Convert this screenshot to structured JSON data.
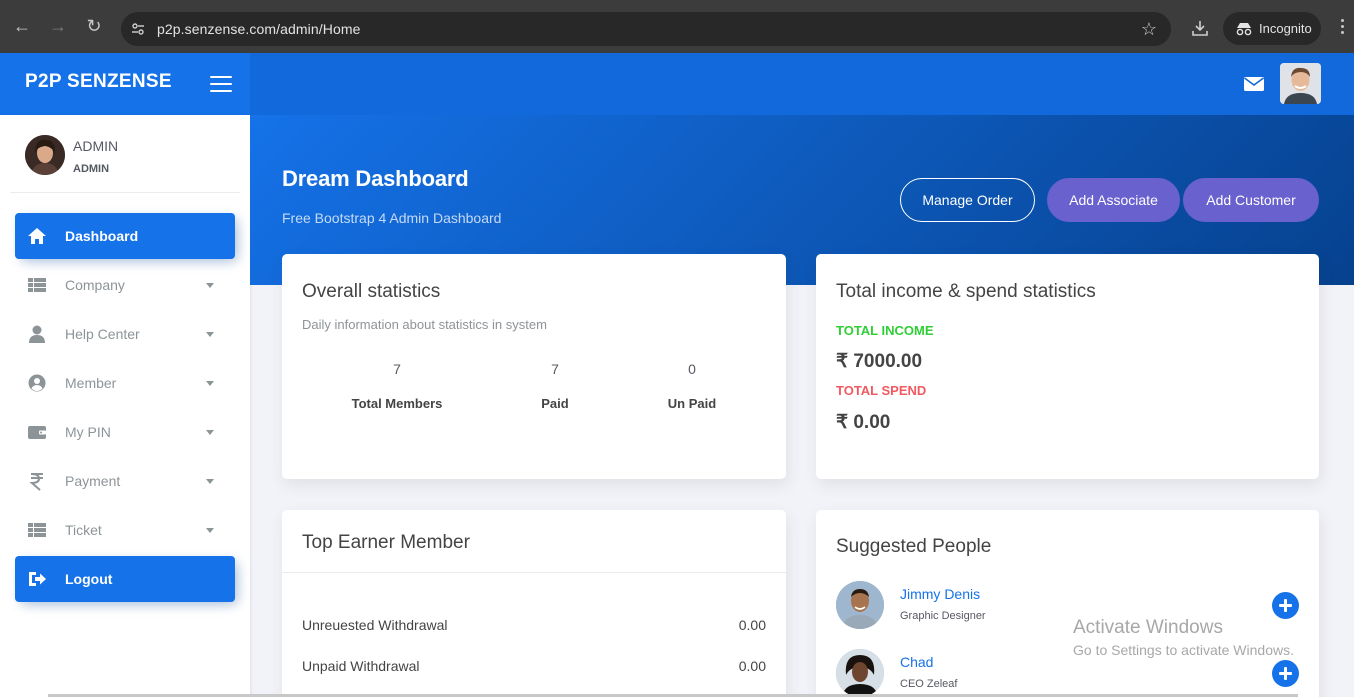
{
  "browser": {
    "url_domain": "p2p.senzense.com",
    "url_path": "/admin/Home",
    "incognito_label": "Incognito"
  },
  "sidebar": {
    "brand": "P2P SENZENSE",
    "user_name": "ADMIN",
    "user_role": "ADMIN",
    "items": [
      {
        "label": "Dashboard",
        "icon": "home-icon",
        "active": true
      },
      {
        "label": "Company",
        "icon": "table-icon"
      },
      {
        "label": "Help Center",
        "icon": "user-icon"
      },
      {
        "label": "Member",
        "icon": "user-circle-icon"
      },
      {
        "label": "My PIN",
        "icon": "wallet-icon"
      },
      {
        "label": "Payment",
        "icon": "rupee-icon"
      },
      {
        "label": "Ticket",
        "icon": "table-icon"
      },
      {
        "label": "Logout",
        "icon": "sign-out-icon",
        "active": true
      }
    ]
  },
  "header": {
    "title": "Dream Dashboard",
    "subtitle": "Free Bootstrap 4 Admin Dashboard",
    "buttons": {
      "manage_order": "Manage Order",
      "add_associate": "Add Associate",
      "add_customer": "Add Customer"
    }
  },
  "overall": {
    "title": "Overall statistics",
    "category": "Daily information about statistics in system",
    "stats": [
      {
        "value": "7",
        "label": "Total Members"
      },
      {
        "value": "7",
        "label": "Paid"
      },
      {
        "value": "0",
        "label": "Un Paid"
      }
    ]
  },
  "income": {
    "title": "Total income & spend statistics",
    "income_label": "TOTAL INCOME",
    "income_value": "₹ 7000.00",
    "spend_label": "TOTAL SPEND",
    "spend_value": "₹ 0.00",
    "income_color": "#31ce36",
    "spend_color": "#f25961"
  },
  "top_earner": {
    "title": "Top Earner Member",
    "rows": [
      {
        "label": "Unreuested Withdrawal",
        "value": "0.00"
      },
      {
        "label": "Unpaid Withdrawal",
        "value": "0.00"
      }
    ]
  },
  "suggested": {
    "title": "Suggested People",
    "people": [
      {
        "name": "Jimmy Denis",
        "role": "Graphic Designer"
      },
      {
        "name": "Chad",
        "role": "CEO Zeleaf"
      }
    ]
  },
  "watermark": {
    "line1": "Activate Windows",
    "line2": "Go to Settings to activate Windows."
  },
  "colors": {
    "primary": "#1572e8",
    "secondary": "#6861ce"
  }
}
